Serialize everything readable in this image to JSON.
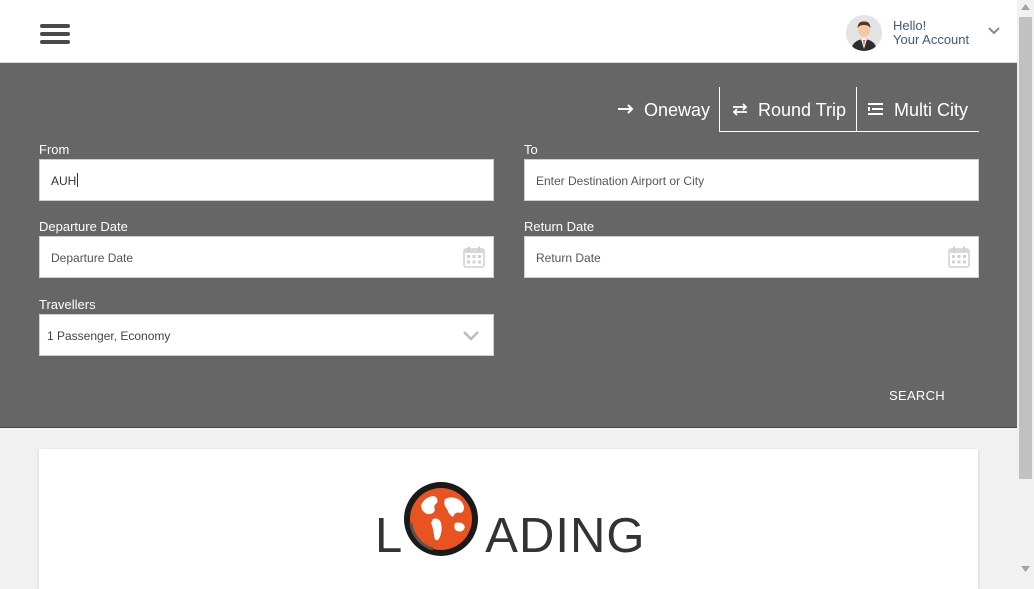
{
  "header": {
    "greeting": "Hello!",
    "account_label": "Your Account"
  },
  "trip_types": [
    {
      "label": "Oneway",
      "icon": "arrow-right-icon"
    },
    {
      "label": "Round Trip",
      "icon": "swap-arrows-icon"
    },
    {
      "label": "Multi City",
      "icon": "list-icon"
    }
  ],
  "form": {
    "from_label": "From",
    "from_value": "AUH",
    "to_label": "To",
    "to_placeholder": "Enter Destination Airport or City",
    "departure_label": "Departure Date",
    "departure_placeholder": "Departure Date",
    "return_label": "Return Date",
    "return_placeholder": "Return Date",
    "travellers_label": "Travellers",
    "travellers_value": "1 Passenger, Economy",
    "search_label": "SEARCH"
  },
  "loading": {
    "text_left": "L",
    "text_right": "ADING"
  },
  "colors": {
    "panel_bg": "#666666",
    "globe_orange": "#e8531f",
    "link_blue": "#3b5a86"
  }
}
